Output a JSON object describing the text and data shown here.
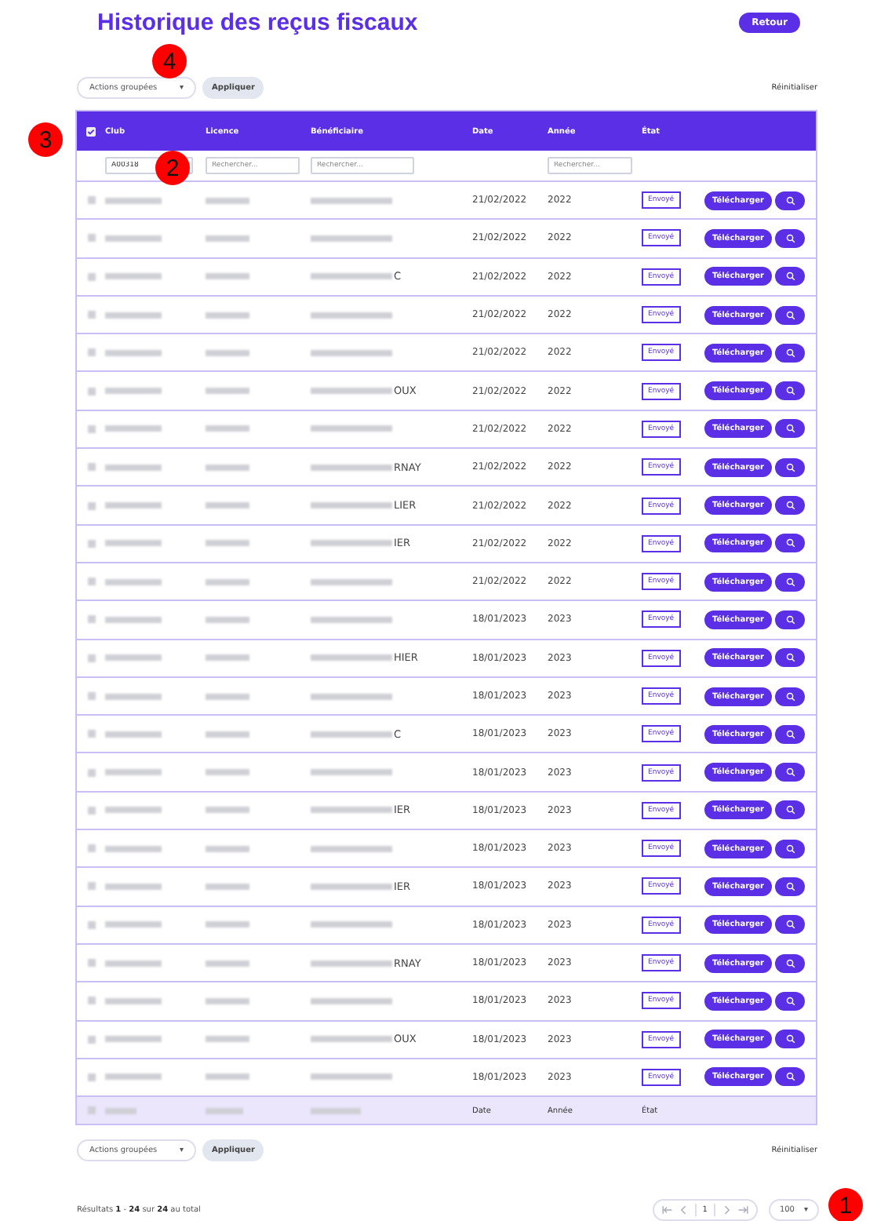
{
  "title": "Historique des reçus fiscaux",
  "back_button": "Retour",
  "bulk_actions_top": {
    "select": "Actions groupées",
    "caret": "▾",
    "apply": "Appliquer",
    "reset": "Réinitialiser"
  },
  "table": {
    "select_all_checked": true,
    "columns": [
      "Club",
      "Licence",
      "Bénéficiaire",
      "Date",
      "Année",
      "État"
    ],
    "filters": {
      "club": "A00318",
      "licence_placeholder": "Rechercher...",
      "beneficiary_placeholder": "Rechercher...",
      "year_placeholder": "Rechercher..."
    },
    "rows": [
      {
        "tail": "",
        "date": "21/02/2022",
        "year": "2022",
        "status": "Envoyé",
        "download": "Télécharger"
      },
      {
        "tail": "",
        "date": "21/02/2022",
        "year": "2022",
        "status": "Envoyé",
        "download": "Télécharger"
      },
      {
        "tail": "C",
        "date": "21/02/2022",
        "year": "2022",
        "status": "Envoyé",
        "download": "Télécharger"
      },
      {
        "tail": "",
        "date": "21/02/2022",
        "year": "2022",
        "status": "Envoyé",
        "download": "Télécharger"
      },
      {
        "tail": "",
        "date": "21/02/2022",
        "year": "2022",
        "status": "Envoyé",
        "download": "Télécharger"
      },
      {
        "tail": "OUX",
        "date": "21/02/2022",
        "year": "2022",
        "status": "Envoyé",
        "download": "Télécharger"
      },
      {
        "tail": "",
        "date": "21/02/2022",
        "year": "2022",
        "status": "Envoyé",
        "download": "Télécharger"
      },
      {
        "tail": "RNAY",
        "date": "21/02/2022",
        "year": "2022",
        "status": "Envoyé",
        "download": "Télécharger"
      },
      {
        "tail": "LIER",
        "date": "21/02/2022",
        "year": "2022",
        "status": "Envoyé",
        "download": "Télécharger"
      },
      {
        "tail": "IER",
        "date": "21/02/2022",
        "year": "2022",
        "status": "Envoyé",
        "download": "Télécharger"
      },
      {
        "tail": "",
        "date": "21/02/2022",
        "year": "2022",
        "status": "Envoyé",
        "download": "Télécharger"
      },
      {
        "tail": "",
        "date": "18/01/2023",
        "year": "2023",
        "status": "Envoyé",
        "download": "Télécharger"
      },
      {
        "tail": "HIER",
        "date": "18/01/2023",
        "year": "2023",
        "status": "Envoyé",
        "download": "Télécharger"
      },
      {
        "tail": "",
        "date": "18/01/2023",
        "year": "2023",
        "status": "Envoyé",
        "download": "Télécharger"
      },
      {
        "tail": "C",
        "date": "18/01/2023",
        "year": "2023",
        "status": "Envoyé",
        "download": "Télécharger"
      },
      {
        "tail": "",
        "date": "18/01/2023",
        "year": "2023",
        "status": "Envoyé",
        "download": "Télécharger"
      },
      {
        "tail": "IER",
        "date": "18/01/2023",
        "year": "2023",
        "status": "Envoyé",
        "download": "Télécharger"
      },
      {
        "tail": "",
        "date": "18/01/2023",
        "year": "2023",
        "status": "Envoyé",
        "download": "Télécharger"
      },
      {
        "tail": "IER",
        "date": "18/01/2023",
        "year": "2023",
        "status": "Envoyé",
        "download": "Télécharger"
      },
      {
        "tail": "",
        "date": "18/01/2023",
        "year": "2023",
        "status": "Envoyé",
        "download": "Télécharger"
      },
      {
        "tail": "RNAY",
        "date": "18/01/2023",
        "year": "2023",
        "status": "Envoyé",
        "download": "Télécharger"
      },
      {
        "tail": "",
        "date": "18/01/2023",
        "year": "2023",
        "status": "Envoyé",
        "download": "Télécharger"
      },
      {
        "tail": "OUX",
        "date": "18/01/2023",
        "year": "2023",
        "status": "Envoyé",
        "download": "Télécharger"
      },
      {
        "tail": "",
        "date": "18/01/2023",
        "year": "2023",
        "status": "Envoyé",
        "download": "Télécharger"
      }
    ],
    "footer": [
      "Date",
      "Année",
      "État"
    ]
  },
  "bulk_actions_bottom": {
    "select": "Actions groupées",
    "caret": "▾",
    "apply": "Appliquer",
    "reset": "Réinitialiser"
  },
  "results": "Résultats **1** - **24** sur **24** au total",
  "pagination": {
    "page": "1",
    "per_page": "100",
    "caret": "▾"
  },
  "annotations": [
    "1",
    "2",
    "3",
    "4"
  ]
}
